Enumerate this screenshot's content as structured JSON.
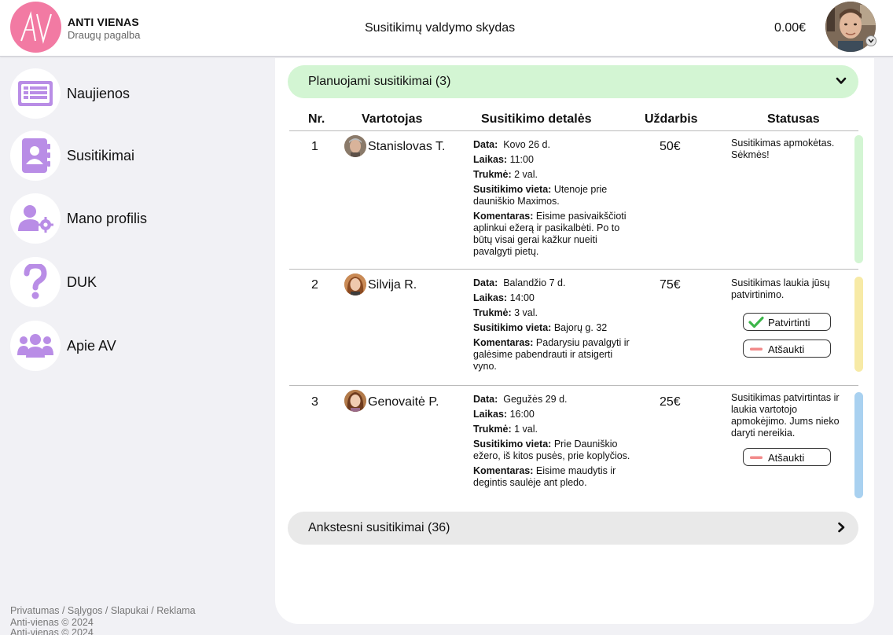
{
  "brand": {
    "logo_text": "AV",
    "name": "ANTI VIENAS",
    "subtitle": "Draugų pagalba"
  },
  "header": {
    "title": "Susitikimų valdymo skydas",
    "balance": "0.00€"
  },
  "sidebar": {
    "items": [
      {
        "label": "Naujienos",
        "icon": "newspaper-icon"
      },
      {
        "label": "Susitikimai",
        "icon": "contacts-book-icon"
      },
      {
        "label": "Mano profilis",
        "icon": "user-settings-icon"
      },
      {
        "label": "DUK",
        "icon": "question-mark-icon"
      },
      {
        "label": "Apie AV",
        "icon": "group-icon"
      }
    ],
    "footer_links": "Privatumas / Sąlygos / Slapukai / Reklama",
    "copyright": "Anti-vienas © 2024"
  },
  "planned": {
    "label": "Planuojami susitikimai (3)",
    "columns": [
      "Nr.",
      "Vartotojas",
      "Susitikimo detalės",
      "Uždarbis",
      "Statusas"
    ],
    "rows": [
      {
        "nr": "1",
        "user": "Stanislovas T.",
        "date_label": "Data:",
        "date": "Kovo 26 d.",
        "time_label": "Laikas:",
        "time": "11:00",
        "duration_label": "Trukmė:",
        "duration": "2 val.",
        "place_label": "Susitikimo vieta:",
        "place": "Utenoje prie dauniškio Maximos.",
        "comment_label": "Komentaras:",
        "comment": "Eisime pasivaikščioti aplinkui ežerą ir pasikalbėti. Po to būtų visai gerai kažkur nueiti pavalgyti pietų.",
        "earnings": "50€",
        "status": "Susitikimas apmokėtas. Sėkmės!",
        "status_color": "#d3f5d3"
      },
      {
        "nr": "2",
        "user": "Silvija R.",
        "date_label": "Data:",
        "date": "Balandžio 7 d.",
        "time_label": "Laikas:",
        "time": "14:00",
        "duration_label": "Trukmė:",
        "duration": "3 val.",
        "place_label": "Susitikimo vieta:",
        "place": "Bajorų g. 32",
        "comment_label": "Komentaras:",
        "comment": "Padarysiu pavalgyti ir galėsime pabendrauti ir atsigerti vyno.",
        "earnings": "75€",
        "status": "Susitikimas laukia jūsų patvirtinimo.",
        "status_color": "#f7eaa6",
        "confirm_label": "Patvirtinti",
        "cancel_label": "Atšaukti"
      },
      {
        "nr": "3",
        "user": "Genovaitė P.",
        "date_label": "Data:",
        "date": "Gegužės 29 d.",
        "time_label": "Laikas:",
        "time": "16:00",
        "duration_label": "Trukmė:",
        "duration": "1 val.",
        "place_label": "Susitikimo vieta:",
        "place": "Prie Dauniškio ežero, iš kitos pusės, prie koplyčios.",
        "comment_label": "Komentaras:",
        "comment": "Eisime maudytis ir degintis saulėje ant pledo.",
        "earnings": "25€",
        "status": "Susitikimas patvirtintas ir laukia vartotojo apmokėjimo. Jums nieko daryti nereikia.",
        "status_color": "#a9d1f0",
        "cancel_label": "Atšaukti"
      }
    ]
  },
  "previous": {
    "label": "Ankstesni susitikimai (36)"
  },
  "colors": {
    "accent_purple": "#b98de6",
    "logo_pink": "#f27aa3",
    "confirm_green": "#3cb64a",
    "cancel_red": "#f28a8a"
  }
}
